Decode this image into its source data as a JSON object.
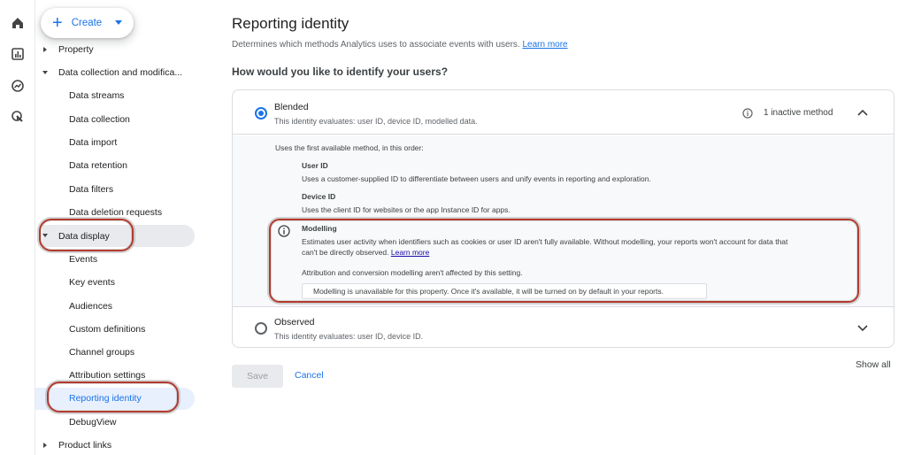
{
  "rail": {
    "icons": [
      "home-icon",
      "reports-icon",
      "explore-icon",
      "advertising-icon"
    ]
  },
  "create_button": {
    "label": "Create"
  },
  "nav": {
    "property": "Property",
    "data_collection": "Data collection and modifica...",
    "data_streams": "Data streams",
    "data_collection_item": "Data collection",
    "data_import": "Data import",
    "data_retention": "Data retention",
    "data_filters": "Data filters",
    "data_deletion": "Data deletion requests",
    "data_display": "Data display",
    "events": "Events",
    "key_events": "Key events",
    "audiences": "Audiences",
    "custom_definitions": "Custom definitions",
    "channel_groups": "Channel groups",
    "attribution_settings": "Attribution settings",
    "reporting_identity": "Reporting identity",
    "debugview": "DebugView",
    "product_links": "Product links"
  },
  "main": {
    "title": "Reporting identity",
    "subtitle": "Determines which methods Analytics uses to associate events with users.",
    "learn_more": "Learn more",
    "question": "How would you like to identify your users?",
    "blended": {
      "label": "Blended",
      "desc": "This identity evaluates: user ID, device ID, modelled data.",
      "inactive": "1 inactive method",
      "selected": true
    },
    "order_intro": "Uses the first available method, in this order:",
    "user_id_title": "User ID",
    "user_id_desc": "Uses a customer-supplied ID to differentiate between users and unify events in reporting and exploration.",
    "device_id_title": "Device ID",
    "device_id_desc": "Uses the client ID for websites or the app Instance ID for apps.",
    "modelling_title": "Modelling",
    "modelling_desc_1": "Estimates user activity when identifiers such as cookies or user ID aren't fully available. Without modelling, your reports won't account for data that",
    "modelling_desc_2": "can't be directly observed.",
    "modelling_learn_more": "Learn more",
    "attribution_note": "Attribution and conversion modelling aren't affected by this setting.",
    "unavailable_notice": "Modelling is unavailable for this property. Once it's available, it will be turned on by default in your reports.",
    "observed": {
      "label": "Observed",
      "desc": "This identity evaluates: user ID, device ID.",
      "selected": false
    },
    "save": "Save",
    "cancel": "Cancel",
    "show_all": "Show all"
  },
  "colors": {
    "accent": "#1a73e8",
    "annotation": "#b23a2e"
  }
}
